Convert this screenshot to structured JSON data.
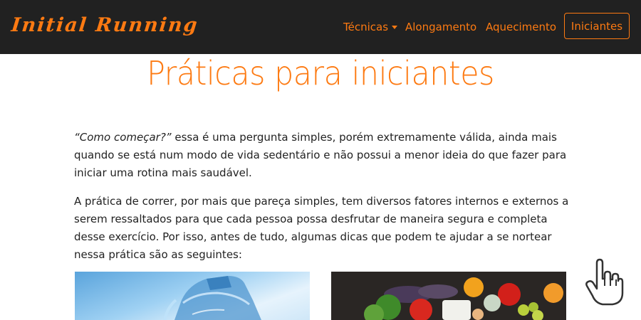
{
  "navbar": {
    "brand": "Initial Running",
    "links": [
      {
        "label": "Técnicas"
      },
      {
        "label": "Alongamento"
      },
      {
        "label": "Aquecimento"
      }
    ],
    "cta_label": "Iniciantes"
  },
  "main": {
    "title": "Práticas para iniciantes",
    "intro_quote": "“Como começar?”",
    "intro_rest": " essa é uma pergunta simples, porém extremamente válida, ainda mais quando se está num modo de vida sedentário e não possui a menor ideia do que fazer para iniciar uma rotina mais saudável.",
    "paragraph2": "A prática de correr, por mais que pareça simples, tem diversos fatores internos e externos a serem ressaltados para que cada pessoa possa desfrutar de maneira segura e completa desse exercício. Por isso, antes de tudo, algumas dicas que podem te ajudar a se nortear nessa prática são as seguintes:"
  },
  "colors": {
    "accent": "#fd7a12",
    "navbar_bg": "#212121",
    "text": "#222222"
  },
  "icons": {
    "cursor": "hand-pointer-icon"
  }
}
